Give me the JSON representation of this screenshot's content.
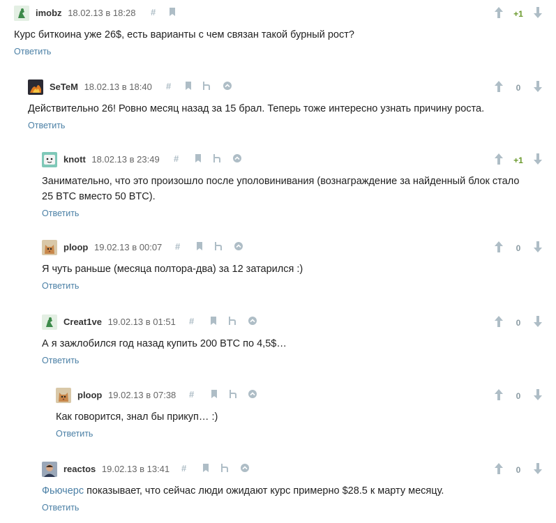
{
  "actions": {
    "reply_label": "Ответить"
  },
  "comments": [
    {
      "username": "imobz",
      "timestamp": "18.02.13 в 18:28",
      "score": "+1",
      "text": "Курс биткоина уже 26$, есть варианты с чем связан такой бурный рост?",
      "avatar": "robot-avatar"
    },
    {
      "username": "SeTeM",
      "timestamp": "18.02.13 в 18:40",
      "score": "0",
      "text": "Действительно 26! Ровно месяц назад за 15 брал. Теперь тоже интересно узнать причину роста.",
      "avatar": "fire-avatar"
    },
    {
      "username": "knott",
      "timestamp": "18.02.13 в 23:49",
      "score": "+1",
      "text": "Занимательно, что это произошло после уполовинивания (вознаграждение за найденный блок стало 25 BTC вместо 50 BTC).",
      "avatar": "cartoon-avatar"
    },
    {
      "username": "ploop",
      "timestamp": "19.02.13 в 00:07",
      "score": "0",
      "text": "Я чуть раньше (месяца полтора-два) за 12 затарился :)",
      "avatar": "cat-avatar"
    },
    {
      "username": "Creat1ve",
      "timestamp": "19.02.13 в 01:51",
      "score": "0",
      "text": "А я зажлобился год назад купить 200 BTC по 4,5$…",
      "avatar": "robot-avatar"
    },
    {
      "username": "ploop",
      "timestamp": "19.02.13 в 07:38",
      "score": "0",
      "text": "Как говорится, знал бы прикуп… :)",
      "avatar": "cat-avatar"
    },
    {
      "username": "reactos",
      "timestamp": "19.02.13 в 13:41",
      "score": "0",
      "text_link": "Фьючерс",
      "text_rest": " показывает, что сейчас люди ожидают курс примерно $28.5 к марту месяцу.",
      "avatar": "person-avatar"
    }
  ]
}
